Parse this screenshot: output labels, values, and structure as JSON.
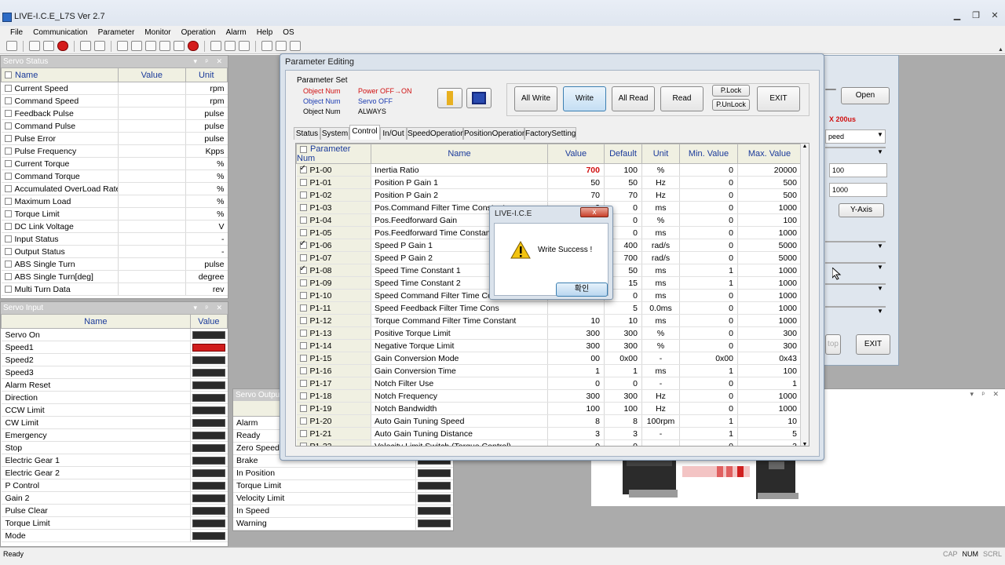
{
  "app": {
    "title": "LIVE-I.C.E_L7S Ver 2.7"
  },
  "menu": [
    "File",
    "Communication",
    "Parameter",
    "Monitor",
    "Operation",
    "Alarm",
    "Help",
    "OS"
  ],
  "servo_status": {
    "title": "Servo Status",
    "headers": {
      "name": "Name",
      "value": "Value",
      "unit": "Unit"
    },
    "rows": [
      {
        "name": "Current Speed",
        "unit": "rpm"
      },
      {
        "name": "Command Speed",
        "unit": "rpm"
      },
      {
        "name": "Feedback Pulse",
        "unit": "pulse"
      },
      {
        "name": "Command Pulse",
        "unit": "pulse"
      },
      {
        "name": "Pulse Error",
        "unit": "pulse"
      },
      {
        "name": "Pulse Frequency",
        "unit": "Kpps"
      },
      {
        "name": "Current Torque",
        "unit": "%"
      },
      {
        "name": "Command Torque",
        "unit": "%"
      },
      {
        "name": "Accumulated OverLoad Rate",
        "unit": "%"
      },
      {
        "name": "Maximum Load",
        "unit": "%"
      },
      {
        "name": "Torque Limit",
        "unit": "%"
      },
      {
        "name": "DC Link Voltage",
        "unit": "V"
      },
      {
        "name": "Input Status",
        "unit": "-"
      },
      {
        "name": "Output Status",
        "unit": "-"
      },
      {
        "name": "ABS Single Turn",
        "unit": "pulse"
      },
      {
        "name": "ABS Single Turn[deg]",
        "unit": "degree"
      },
      {
        "name": "Multi Turn Data",
        "unit": "rev"
      }
    ]
  },
  "servo_input": {
    "title": "Servo Input",
    "headers": {
      "name": "Name",
      "value": "Value"
    },
    "rows": [
      {
        "name": "Servo On",
        "state": "off"
      },
      {
        "name": "Speed1",
        "state": "on"
      },
      {
        "name": "Speed2",
        "state": "off"
      },
      {
        "name": "Speed3",
        "state": "off"
      },
      {
        "name": "Alarm Reset",
        "state": "off"
      },
      {
        "name": "Direction",
        "state": "off"
      },
      {
        "name": "CCW Limit",
        "state": "off"
      },
      {
        "name": "CW Limit",
        "state": "off"
      },
      {
        "name": "Emergency",
        "state": "off"
      },
      {
        "name": "Stop",
        "state": "off"
      },
      {
        "name": "Electric Gear 1",
        "state": "off"
      },
      {
        "name": "Electric Gear 2",
        "state": "off"
      },
      {
        "name": "P Control",
        "state": "off"
      },
      {
        "name": "Gain 2",
        "state": "off"
      },
      {
        "name": "Pulse Clear",
        "state": "off"
      },
      {
        "name": "Torque Limit",
        "state": "off"
      },
      {
        "name": "Mode",
        "state": "off"
      }
    ]
  },
  "servo_output": {
    "title": "Servo Output",
    "rows": [
      "Alarm",
      "Ready",
      "Zero Speed",
      "Brake",
      "In Position",
      "Torque Limit",
      "Velocity Limit",
      "In Speed",
      "Warning"
    ]
  },
  "bg_dialog": {
    "open": "Open",
    "sample": "X 200us",
    "select1": "peed",
    "field1": "100",
    "field2": "1000",
    "yaxis": "Y-Axis",
    "stop": "top",
    "exit": "EXIT"
  },
  "param_dialog": {
    "title": "Parameter Editing",
    "param_set": {
      "label": "Parameter Set",
      "rows": [
        {
          "a": "Object Num",
          "b": "Power OFF→ON",
          "color": "#d01010"
        },
        {
          "a": "Object Num",
          "b": "Servo OFF",
          "color": "#1a3ab0"
        },
        {
          "a": "Object Num",
          "b": "ALWAYS",
          "color": "#000000"
        }
      ]
    },
    "buttons": {
      "all_write": "All Write",
      "write": "Write",
      "all_read": "All Read",
      "read": "Read",
      "plock": "P.Lock",
      "punlock": "P.UnLock",
      "exit": "EXIT"
    },
    "tabs": [
      "Status",
      "System",
      "Control",
      "In/Out",
      "SpeedOperation",
      "PositionOperation",
      "FactorySetting"
    ],
    "active_tab": "Control",
    "headers": {
      "num": "Parameter Num",
      "name": "Name",
      "value": "Value",
      "default": "Default",
      "unit": "Unit",
      "min": "Min. Value",
      "max": "Max. Value"
    },
    "rows": [
      {
        "num": "P1-00",
        "name": "Inertia Ratio",
        "value": "700",
        "default": "100",
        "unit": "%",
        "min": "0",
        "max": "20000",
        "checked": true,
        "highlight": true
      },
      {
        "num": "P1-01",
        "name": "Position P Gain 1",
        "value": "50",
        "default": "50",
        "unit": "Hz",
        "min": "0",
        "max": "500",
        "checked": false
      },
      {
        "num": "P1-02",
        "name": "Position P Gain 2",
        "value": "70",
        "default": "70",
        "unit": "Hz",
        "min": "0",
        "max": "500",
        "checked": false
      },
      {
        "num": "P1-03",
        "name": "Pos.Command Filter Time Constant",
        "value": "0",
        "default": "0",
        "unit": "ms",
        "min": "0",
        "max": "1000",
        "checked": false
      },
      {
        "num": "P1-04",
        "name": "Pos.Feedforward Gain",
        "value": "0",
        "default": "0",
        "unit": "%",
        "min": "0",
        "max": "100",
        "checked": false
      },
      {
        "num": "P1-05",
        "name": "Pos.Feedforward Time Constant",
        "value": "0",
        "default": "0",
        "unit": "ms",
        "min": "0",
        "max": "1000",
        "checked": false
      },
      {
        "num": "P1-06",
        "name": "Speed P Gain 1",
        "value": "",
        "default": "400",
        "unit": "rad/s",
        "min": "0",
        "max": "5000",
        "checked": true
      },
      {
        "num": "P1-07",
        "name": "Speed P Gain 2",
        "value": "",
        "default": "700",
        "unit": "rad/s",
        "min": "0",
        "max": "5000",
        "checked": false
      },
      {
        "num": "P1-08",
        "name": "Speed Time Constant 1",
        "value": "",
        "default": "50",
        "unit": "ms",
        "min": "1",
        "max": "1000",
        "checked": true
      },
      {
        "num": "P1-09",
        "name": "Speed Time Constant 2",
        "value": "",
        "default": "15",
        "unit": "ms",
        "min": "1",
        "max": "1000",
        "checked": false
      },
      {
        "num": "P1-10",
        "name": "Speed Command Filter Time Cons",
        "value": "",
        "default": "0",
        "unit": "ms",
        "min": "0",
        "max": "1000",
        "checked": false
      },
      {
        "num": "P1-11",
        "name": "Speed Feedback Filter Time Cons",
        "value": "",
        "default": "5",
        "unit": "0.0ms",
        "min": "0",
        "max": "1000",
        "checked": false
      },
      {
        "num": "P1-12",
        "name": "Torque Command Filter Time Constant",
        "value": "10",
        "default": "10",
        "unit": "ms",
        "min": "0",
        "max": "1000",
        "checked": false
      },
      {
        "num": "P1-13",
        "name": "Positive Torque Limit",
        "value": "300",
        "default": "300",
        "unit": "%",
        "min": "0",
        "max": "300",
        "checked": false
      },
      {
        "num": "P1-14",
        "name": "Negative Torque Limit",
        "value": "300",
        "default": "300",
        "unit": "%",
        "min": "0",
        "max": "300",
        "checked": false
      },
      {
        "num": "P1-15",
        "name": "Gain Conversion Mode",
        "value": "00",
        "default": "0x00",
        "unit": "-",
        "min": "0x00",
        "max": "0x43",
        "checked": false
      },
      {
        "num": "P1-16",
        "name": "Gain Conversion Time",
        "value": "1",
        "default": "1",
        "unit": "ms",
        "min": "1",
        "max": "100",
        "checked": false
      },
      {
        "num": "P1-17",
        "name": "Notch Filter Use",
        "value": "0",
        "default": "0",
        "unit": "-",
        "min": "0",
        "max": "1",
        "checked": false
      },
      {
        "num": "P1-18",
        "name": "Notch Frequency",
        "value": "300",
        "default": "300",
        "unit": "Hz",
        "min": "0",
        "max": "1000",
        "checked": false
      },
      {
        "num": "P1-19",
        "name": "Notch Bandwidth",
        "value": "100",
        "default": "100",
        "unit": "Hz",
        "min": "0",
        "max": "1000",
        "checked": false
      },
      {
        "num": "P1-20",
        "name": "Auto Gain Tuning Speed",
        "value": "8",
        "default": "8",
        "unit": "100rpm",
        "min": "1",
        "max": "10",
        "checked": false
      },
      {
        "num": "P1-21",
        "name": "Auto Gain Tuning Distance",
        "value": "3",
        "default": "3",
        "unit": "-",
        "min": "1",
        "max": "5",
        "checked": false
      },
      {
        "num": "P1-22",
        "name": "Velocity Limit Switch (Torque Control)",
        "value": "0",
        "default": "0",
        "unit": "-",
        "min": "0",
        "max": "3",
        "checked": false
      }
    ]
  },
  "msgbox": {
    "title": "LIVE-I.C.E",
    "message": "Write Success !",
    "ok": "확인",
    "close": "x"
  },
  "status_bar": {
    "text": "Ready",
    "keys": [
      "CAP",
      "NUM",
      "SCRL"
    ]
  },
  "colors": {
    "highlight_value": "#d01010",
    "led_on": "#d01c1c",
    "led_off": "#2a2a2a"
  }
}
